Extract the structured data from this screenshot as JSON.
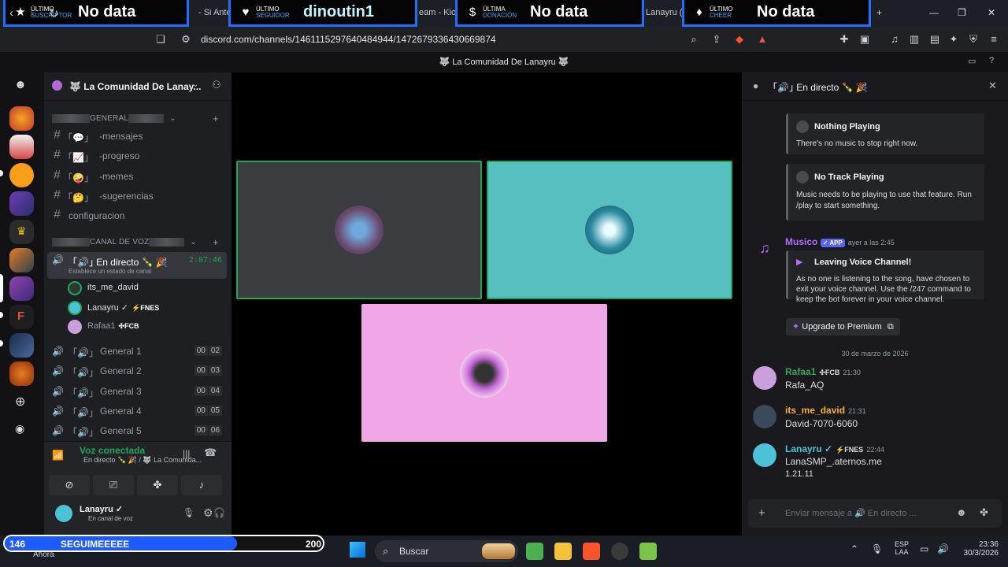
{
  "overlays": [
    {
      "icon": "star-icon",
      "label1": "ÚLTIMO",
      "label2": "SUSCRIPTOR",
      "value": "No data"
    },
    {
      "icon": "heart-icon",
      "label1": "ÚLTIMO",
      "label2": "SEGUIDOR",
      "value": "dinoutin1"
    },
    {
      "icon": "dollar-icon",
      "label1": "ÚLTIMA",
      "label2": "DONACIÓN",
      "value": "No data"
    },
    {
      "icon": "diamond-icon",
      "label1": "ÚLTIMO",
      "label2": "CHEER",
      "value": "No data"
    }
  ],
  "browser": {
    "tab_texts": [
      "- Si Antes",
      "eam - Kick",
      "Lanayru (@"
    ],
    "url": "discord.com/channels/1461115297640484944/1472679336430669874"
  },
  "discord": {
    "window_title": "🐺 La Comunidad De Lanayru 🐺",
    "server_name": "🐺 La Comunidad De Lanay...",
    "categories": {
      "general": "GENERAL",
      "voice": "CANAL DE VOZ"
    },
    "text_channels": [
      "-mensajes",
      "-progreso",
      "-memes",
      "-sugerencias"
    ],
    "config_channel": "configuracion",
    "live_channel": {
      "name": "En directo",
      "timer": "2:07:46",
      "status": "Establece un estado de canal"
    },
    "voice_users": [
      {
        "name": "its_me_david",
        "tag": "",
        "color": "#dbdee1"
      },
      {
        "name": "Lanayru ✓",
        "tag": "FNES",
        "color": "#dbdee1"
      },
      {
        "name": "Rafaa1",
        "tag": "FCB",
        "color": "#949ba4"
      }
    ],
    "voice_channels": [
      {
        "name": "General 1",
        "a": "00",
        "b": "02"
      },
      {
        "name": "General 2",
        "a": "00",
        "b": "03"
      },
      {
        "name": "General 3",
        "a": "00",
        "b": "04"
      },
      {
        "name": "General 4",
        "a": "00",
        "b": "05"
      },
      {
        "name": "General 5",
        "a": "00",
        "b": "06"
      }
    ],
    "voice_status": {
      "title": "Voz conectada",
      "sub": "En directo 🍾 🎉 / 🐺 La Comunida..."
    },
    "me": {
      "name": "Lanayru ✓",
      "status": "En canal de voz"
    }
  },
  "chat": {
    "channel": "En directo 🍾 🎉",
    "embeds": [
      {
        "title": "Nothing Playing",
        "text": "There's no music to stop right now."
      },
      {
        "title": "No Track Playing",
        "text": "Music needs to be playing to use that feature. Run /play to start something."
      }
    ],
    "bot": {
      "name": "Musico",
      "badge": "✓ APP",
      "time": "ayer a las 2:45",
      "embed_title": "Leaving Voice Channel!",
      "embed_text": "As no one is listening to the song, have chosen to exit your voice channel. Use the /247 command to keep the bot forever in your voice channel.",
      "button": "Upgrade to Premium"
    },
    "date_divider": "30 de marzo de 2026",
    "messages": [
      {
        "name": "Rafaa1",
        "tag": "FCB",
        "time": "21:30",
        "text": "Rafa_AQ",
        "color": "#3ba55d"
      },
      {
        "name": "its_me_david",
        "tag": "",
        "time": "21:31",
        "text": "David-7070-6060",
        "color": "#f0b232"
      },
      {
        "name": "Lanayru ✓",
        "tag": "FNES",
        "time": "22:44",
        "text": "LanaSMP_.aternos.me",
        "text2": "1.21.11",
        "color": "#4cc2d9"
      }
    ],
    "input_placeholder": "Enviar mensaje a 🔊 En directo ..."
  },
  "follow_bar": {
    "current": "146",
    "label": "SEGUIMEEEEE",
    "goal": "200",
    "progress": 0.73,
    "footer": "Ahora"
  },
  "taskbar": {
    "search": "Buscar",
    "lang1": "ESP",
    "lang2": "LAA",
    "time": "23:36",
    "date": "30/3/2026"
  }
}
